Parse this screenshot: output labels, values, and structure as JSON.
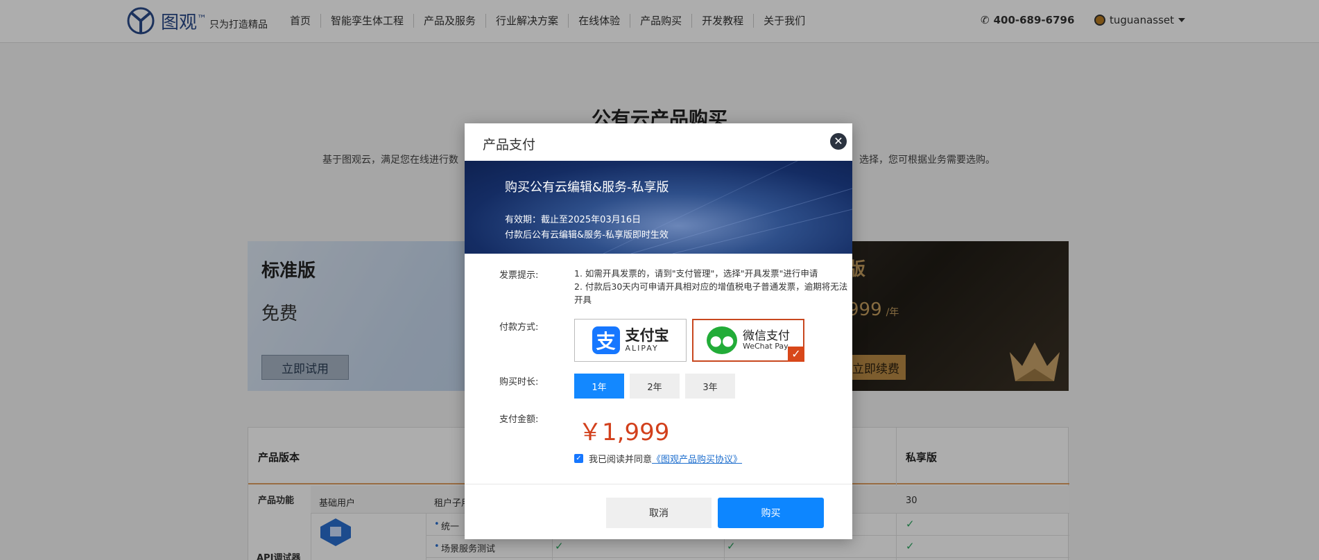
{
  "header": {
    "logo_text": "图观",
    "logo_tm": "™",
    "logo_slogan": "只为打造精品",
    "nav": [
      "首页",
      "智能孪生体工程",
      "产品及服务",
      "行业解决方案",
      "在线体验",
      "产品购买",
      "开发教程",
      "关于我们"
    ],
    "phone": "400-689-6796",
    "username": "tuguanasset"
  },
  "page": {
    "title": "公有云产品购买",
    "desc_left": "基于图观云，满足您在线进行数",
    "desc_right": "选择，您可根据业务需要选购。"
  },
  "cards": {
    "standard": {
      "title": "标准版",
      "price": "免费",
      "button": "立即试用"
    },
    "private": {
      "title": "版",
      "price": "999",
      "unit": "/年",
      "button": "立即续费"
    }
  },
  "table": {
    "col_version": "产品版本",
    "col_private": "私享版",
    "row_function": "产品功能",
    "row_basic_user": "基础用户",
    "row_tenant": "租户子用",
    "row_count": "30",
    "row_item1": "统一",
    "row_item2": "场景服务测试",
    "api_label": "API调试器",
    "tick": "✓"
  },
  "modal": {
    "title": "产品支付",
    "banner": {
      "title": "购买公有云编辑&服务-私享版",
      "validity": "有效期：截止至2025年03月16日",
      "effect": "付款后公有云编辑&服务-私享版即时生效"
    },
    "invoice_label": "发票提示:",
    "invoice_note_1": "1. 如需开具发票的，请到\"支付管理\"，选择\"开具发票\"进行申请",
    "invoice_note_2": "2. 付款后30天内可申请开具相对应的增值税电子普通发票，逾期将无法开具",
    "payment_label": "付款方式:",
    "alipay": {
      "mark": "支",
      "main": "支付宝",
      "sub": "ALIPAY"
    },
    "wechat": {
      "main": "微信支付",
      "sub": "WeChat Pay"
    },
    "duration_label": "购买时长:",
    "durations": [
      "1年",
      "2年",
      "3年"
    ],
    "amount_label": "支付金额:",
    "amount": "￥1,999",
    "agree_text": "我已阅读并同意",
    "agree_link": "《图观产品购买协议》",
    "cancel": "取消",
    "buy": "购买",
    "close": "✕"
  },
  "colors": {
    "accent_blue": "#1388ff",
    "price_red": "#d2401c",
    "selected_border": "#c8471f"
  }
}
